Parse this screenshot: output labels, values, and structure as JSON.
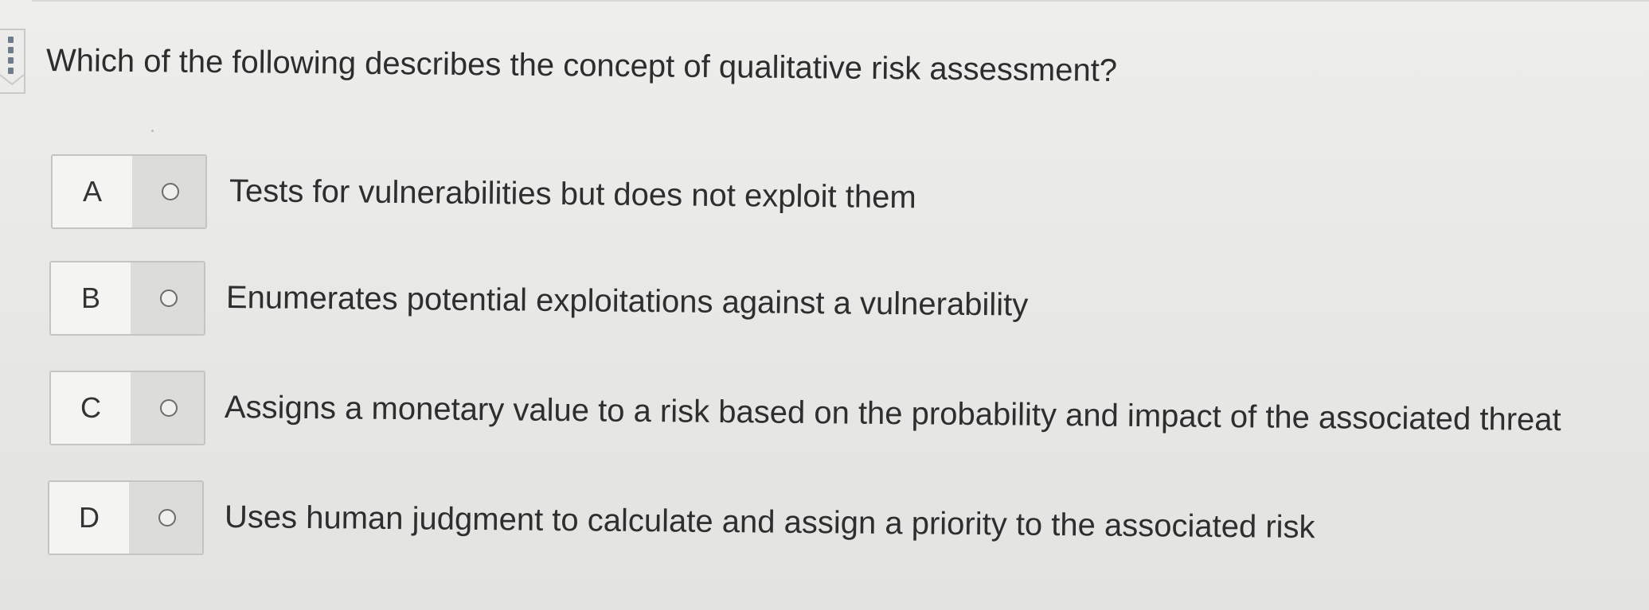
{
  "question": {
    "text": "Which of the following describes the concept of qualitative risk assessment?"
  },
  "options": [
    {
      "letter": "A",
      "text": "Tests for vulnerabilities but does not exploit them"
    },
    {
      "letter": "B",
      "text": "Enumerates potential exploitations against a vulnerability"
    },
    {
      "letter": "C",
      "text": "Assigns a monetary value to a risk based on the probability and impact of the associated threat"
    },
    {
      "letter": "D",
      "text": "Uses human judgment to calculate and assign a priority to the associated risk"
    }
  ],
  "colors": {
    "page_background": "#eeeeec",
    "radio_cell": "#dcdcda",
    "box_border": "#c4c4c2",
    "text": "#2e2e2e",
    "bookmark_icon": "#6e7c8e"
  },
  "icons": {
    "bookmark": "bookmark-icon",
    "radio": "radio-button-icon"
  }
}
